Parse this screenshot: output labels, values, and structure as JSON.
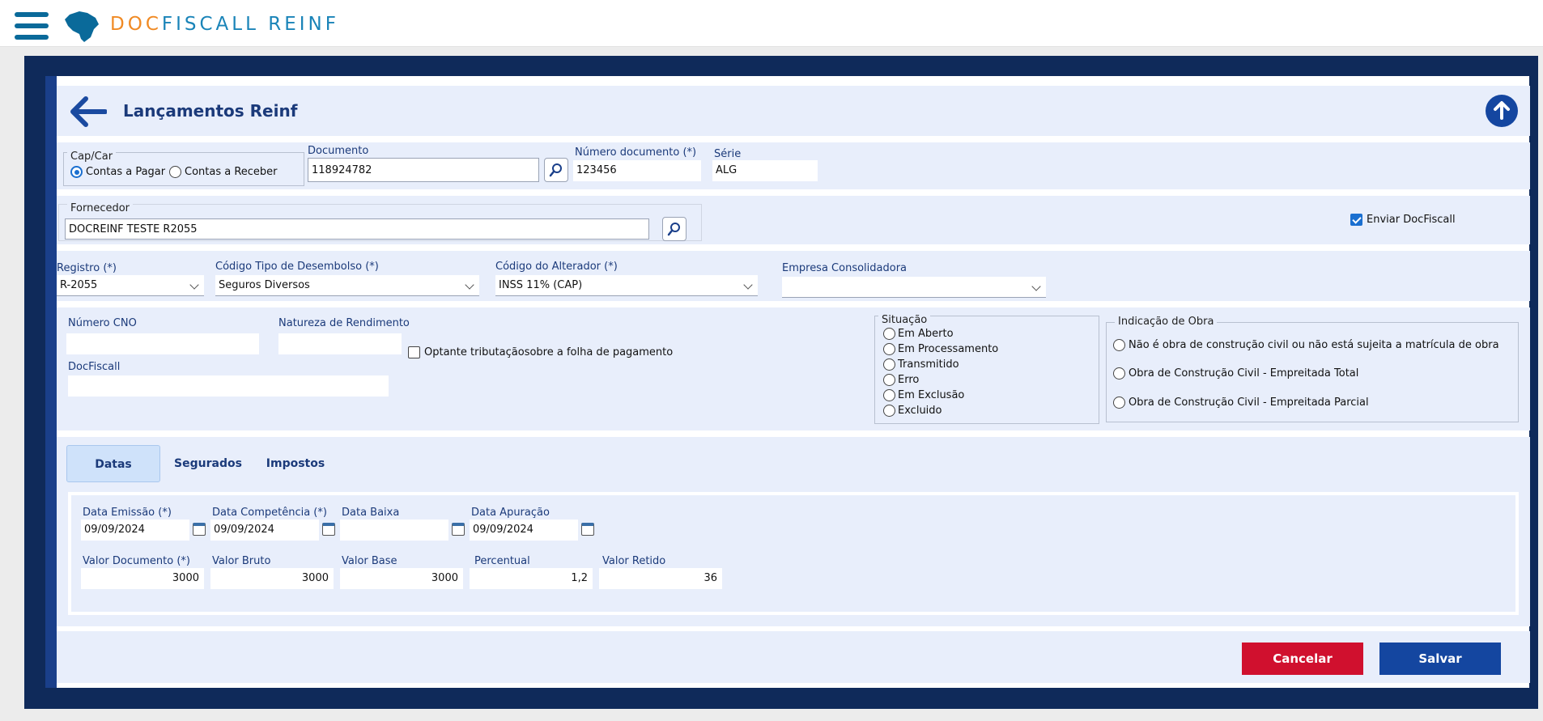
{
  "header": {
    "brand_part1": "DOC",
    "brand_part2": "FISCALL REINF"
  },
  "page": {
    "title": "Lançamentos Reinf"
  },
  "capcar": {
    "legend": "Cap/Car",
    "options": [
      "Contas a Pagar",
      "Contas a Receber"
    ],
    "selected": "Contas a Pagar"
  },
  "documento": {
    "label": "Documento",
    "value": "118924782"
  },
  "numero_documento": {
    "label": "Número documento (*)",
    "value": "123456"
  },
  "serie": {
    "label": "Série",
    "value": "ALG"
  },
  "fornecedor": {
    "legend": "Fornecedor",
    "value": "DOCREINF TESTE R2055"
  },
  "enviar_docfiscall": {
    "label": "Enviar DocFiscall",
    "checked": true
  },
  "registro": {
    "label": "Registro (*)",
    "value": "R-2055"
  },
  "codigo_tipo_desembolso": {
    "label": "Código Tipo de Desembolso (*)",
    "value": "Seguros Diversos"
  },
  "codigo_alterador": {
    "label": "Código do Alterador (*)",
    "value": "INSS 11% (CAP)"
  },
  "empresa_consolidadora": {
    "label": "Empresa Consolidadora",
    "value": ""
  },
  "numero_cno": {
    "label": "Número CNO",
    "value": ""
  },
  "natureza_rendimento": {
    "label": "Natureza de Rendimento",
    "value": ""
  },
  "optante": {
    "label": "Optante tributaçãosobre a folha de pagamento",
    "checked": false
  },
  "docfiscall_field": {
    "label": "DocFiscall",
    "value": ""
  },
  "situacao": {
    "legend": "Situação",
    "options": [
      "Em Aberto",
      "Em Processamento",
      "Transmitido",
      "Erro",
      "Em Exclusão",
      "Excluido"
    ]
  },
  "indicacao_obra": {
    "legend": "Indicação de Obra",
    "options": [
      "Não é obra de construção civil ou não está sujeita a matrícula de obra",
      "Obra de Construção Civil - Empreitada Total",
      "Obra de Construção Civil - Empreitada Parcial"
    ]
  },
  "tabs": [
    {
      "label": "Datas",
      "active": true
    },
    {
      "label": "Segurados",
      "active": false
    },
    {
      "label": "Impostos",
      "active": false
    }
  ],
  "datas": {
    "data_emissao": {
      "label": "Data Emissão (*)",
      "value": "09/09/2024"
    },
    "data_competencia": {
      "label": "Data Competência (*)",
      "value": "09/09/2024"
    },
    "data_baixa": {
      "label": "Data Baixa",
      "value": ""
    },
    "data_apuracao": {
      "label": "Data Apuração",
      "value": "09/09/2024"
    }
  },
  "valores": {
    "valor_documento": {
      "label": "Valor Documento (*)",
      "value": "3000"
    },
    "valor_bruto": {
      "label": "Valor Bruto",
      "value": "3000"
    },
    "valor_base": {
      "label": "Valor Base",
      "value": "3000"
    },
    "percentual": {
      "label": "Percentual",
      "value": "1,2"
    },
    "valor_retido": {
      "label": "Valor Retido",
      "value": "36"
    }
  },
  "actions": {
    "cancel": "Cancelar",
    "save": "Salvar"
  },
  "colors": {
    "navy": "#0f2a5a",
    "accent": "#1a3f8a",
    "cancel": "#d0102e",
    "save": "#1446a0",
    "brand_orange": "#f08a24",
    "brand_blue": "#1a84b8"
  }
}
